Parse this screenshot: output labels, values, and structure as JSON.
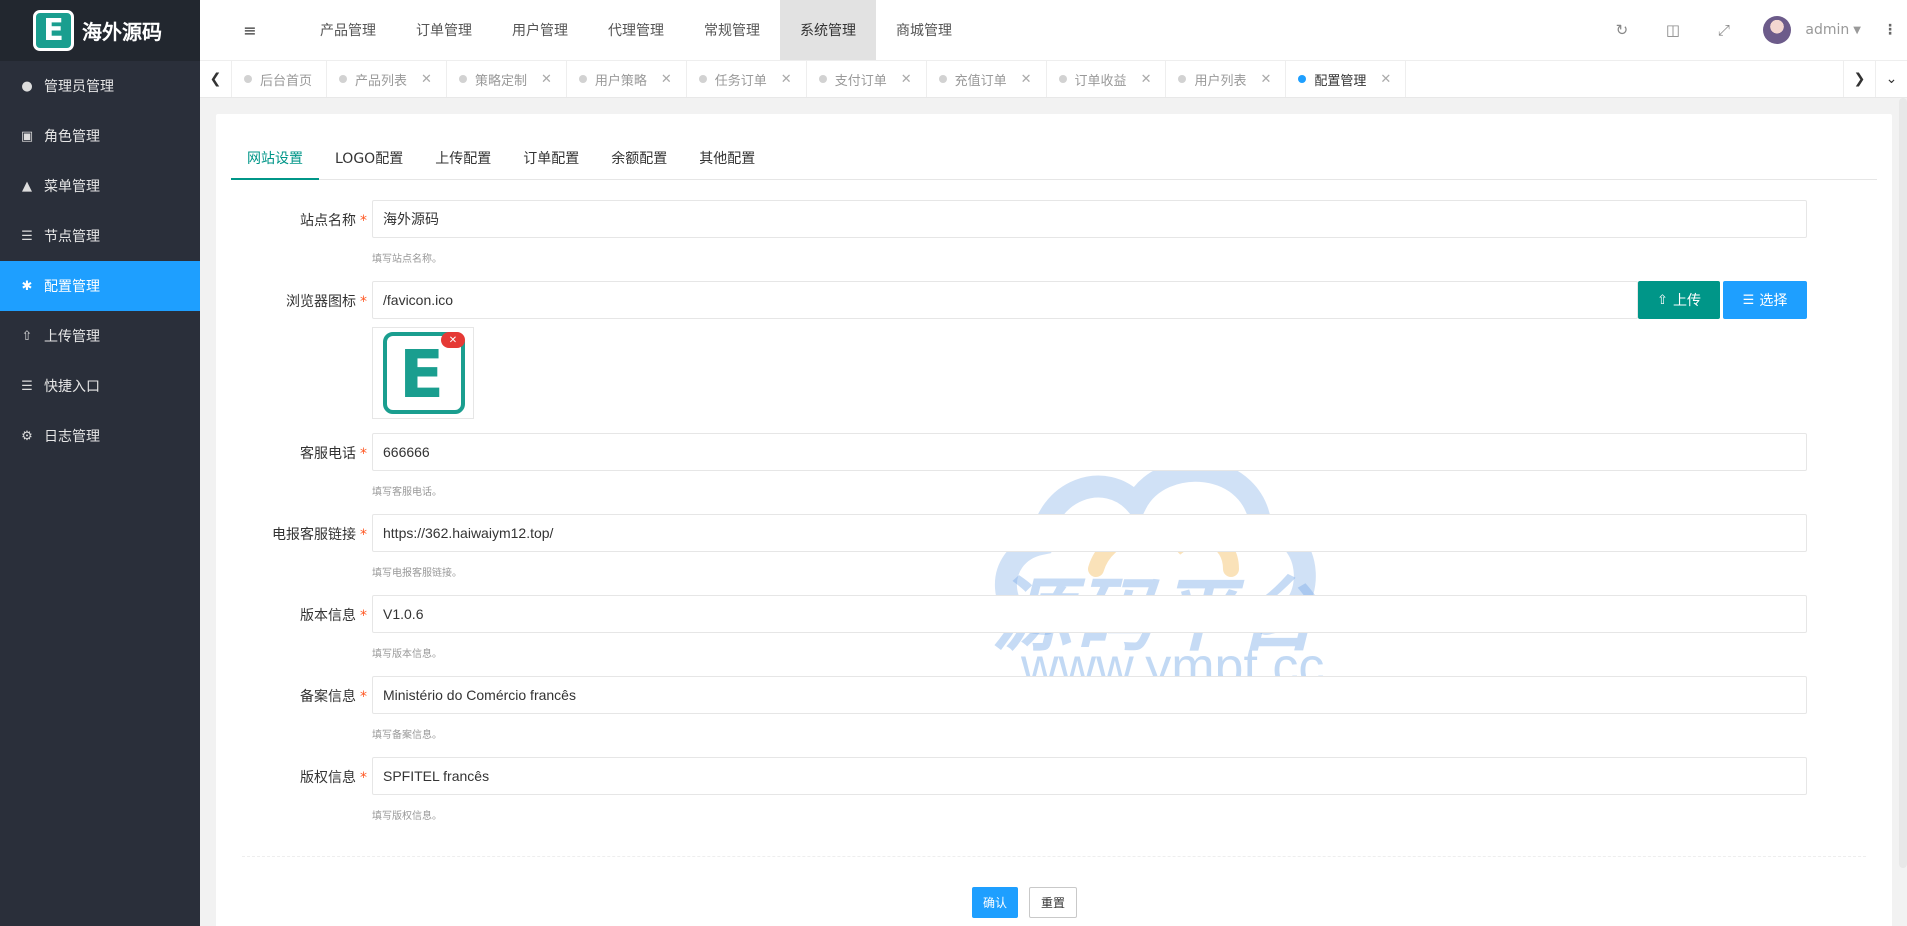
{
  "brand": {
    "logo_letter": "E",
    "name": "海外源码"
  },
  "sidebar": {
    "items": [
      {
        "label": "管理员管理",
        "icon": "user-icon"
      },
      {
        "label": "角色管理",
        "icon": "role-icon"
      },
      {
        "label": "菜单管理",
        "icon": "tree-icon"
      },
      {
        "label": "节点管理",
        "icon": "list-icon"
      },
      {
        "label": "配置管理",
        "icon": "gear-icon",
        "active": true
      },
      {
        "label": "上传管理",
        "icon": "upload-icon"
      },
      {
        "label": "快捷入口",
        "icon": "list-icon"
      },
      {
        "label": "日志管理",
        "icon": "log-icon"
      }
    ]
  },
  "header": {
    "nav": [
      "产品管理",
      "订单管理",
      "用户管理",
      "代理管理",
      "常规管理",
      "系统管理",
      "商城管理"
    ],
    "active_nav": "系统管理",
    "username": "admin"
  },
  "tabs": {
    "items": [
      "后台首页",
      "产品列表",
      "策略定制",
      "用户策略",
      "任务订单",
      "支付订单",
      "充值订单",
      "订单收益",
      "用户列表",
      "配置管理"
    ],
    "active": "配置管理"
  },
  "subtabs": {
    "items": [
      "网站设置",
      "LOGO配置",
      "上传配置",
      "订单配置",
      "余额配置",
      "其他配置"
    ],
    "active": "网站设置"
  },
  "form": {
    "site_name": {
      "label": "站点名称",
      "value": "海外源码",
      "help": "填写站点名称。"
    },
    "favicon": {
      "label": "浏览器图标",
      "value": "/favicon.ico",
      "upload_label": "上传",
      "select_label": "选择"
    },
    "phone": {
      "label": "客服电话",
      "value": "666666",
      "help": "填写客服电话。"
    },
    "telegram": {
      "label": "电报客服链接",
      "value": "https://362.haiwaiym12.top/",
      "help": "填写电报客服链接。"
    },
    "version": {
      "label": "版本信息",
      "value": "V1.0.6",
      "help": "填写版本信息。"
    },
    "icp": {
      "label": "备案信息",
      "value": "Ministério do Comércio francês",
      "help": "填写备案信息。"
    },
    "copyright": {
      "label": "版权信息",
      "value": "SPFITEL francês",
      "help": "填写版权信息。"
    },
    "required_mark": "*"
  },
  "actions": {
    "confirm": "确认",
    "reset": "重置"
  },
  "watermark": {
    "title": "源码平台",
    "url": "www.ympt.cc"
  },
  "colors": {
    "sidebar": "#2a2f3a",
    "active": "#1e9fff",
    "teal": "#009688"
  }
}
